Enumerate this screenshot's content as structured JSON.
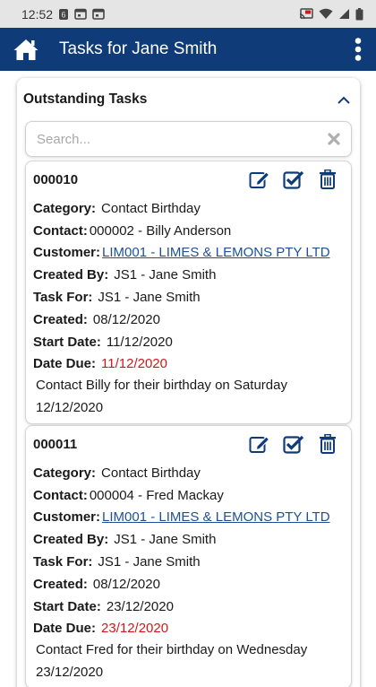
{
  "status": {
    "time": "12:52"
  },
  "app_bar": {
    "title": "Tasks for Jane Smith"
  },
  "panel": {
    "title": "Outstanding Tasks",
    "search_placeholder": "Search..."
  },
  "labels": {
    "category": "Category:",
    "contact": "Contact:",
    "customer": "Customer:",
    "created_by": "Created By:",
    "task_for": "Task For:",
    "created": "Created:",
    "start_date": "Start Date:",
    "date_due": "Date Due:"
  },
  "tasks": [
    {
      "id": "000010",
      "category": "Contact Birthday",
      "contact": "000002 - Billy Anderson",
      "customer": "LIM001 - LIMES & LEMONS PTY LTD",
      "created_by": "JS1 - Jane Smith",
      "task_for": "JS1 - Jane Smith",
      "created": "08/12/2020",
      "start_date": "11/12/2020",
      "date_due": "11/12/2020",
      "note": "Contact Billy for their birthday on Saturday 12/12/2020"
    },
    {
      "id": "000011",
      "category": "Contact Birthday",
      "contact": "000004 - Fred Mackay",
      "customer": "LIM001 - LIMES & LEMONS PTY LTD",
      "created_by": "JS1 - Jane Smith",
      "task_for": "JS1 - Jane Smith",
      "created": "08/12/2020",
      "start_date": "23/12/2020",
      "date_due": "23/12/2020",
      "note": "Contact Fred for their birthday on Wednesday 23/12/2020"
    }
  ],
  "colors": {
    "app_bar": "#0f3b78",
    "icon": "#0f3b78",
    "link": "#1f4f96",
    "due": "#d0181b"
  },
  "icons": {
    "home": "home-icon",
    "more": "more-vertical-icon",
    "collapse": "chevron-up-icon",
    "clear": "close-icon",
    "edit": "edit-icon",
    "complete": "check-square-icon",
    "delete": "trash-icon"
  }
}
